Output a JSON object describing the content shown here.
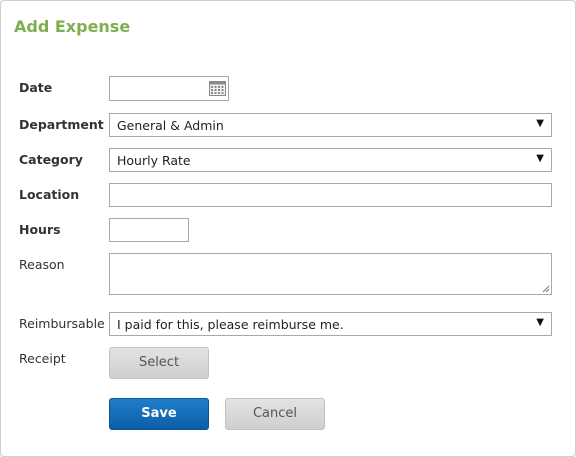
{
  "dialog": {
    "title": "Add Expense"
  },
  "form": {
    "date": {
      "label": "Date",
      "value": "",
      "icon": "calendar-icon"
    },
    "department": {
      "label": "Department",
      "selected": "General & Admin"
    },
    "category": {
      "label": "Category",
      "selected": "Hourly Rate"
    },
    "location": {
      "label": "Location",
      "value": ""
    },
    "hours": {
      "label": "Hours",
      "value": ""
    },
    "reason": {
      "label": "Reason",
      "value": ""
    },
    "reimbursable": {
      "label": "Reimbursable",
      "selected": "I paid for this, please reimburse me."
    },
    "receipt": {
      "label": "Receipt",
      "button_label": "Select"
    }
  },
  "actions": {
    "save_label": "Save",
    "cancel_label": "Cancel"
  },
  "colors": {
    "title": "#7fae4e",
    "primary_button": "#0d6cb8"
  }
}
